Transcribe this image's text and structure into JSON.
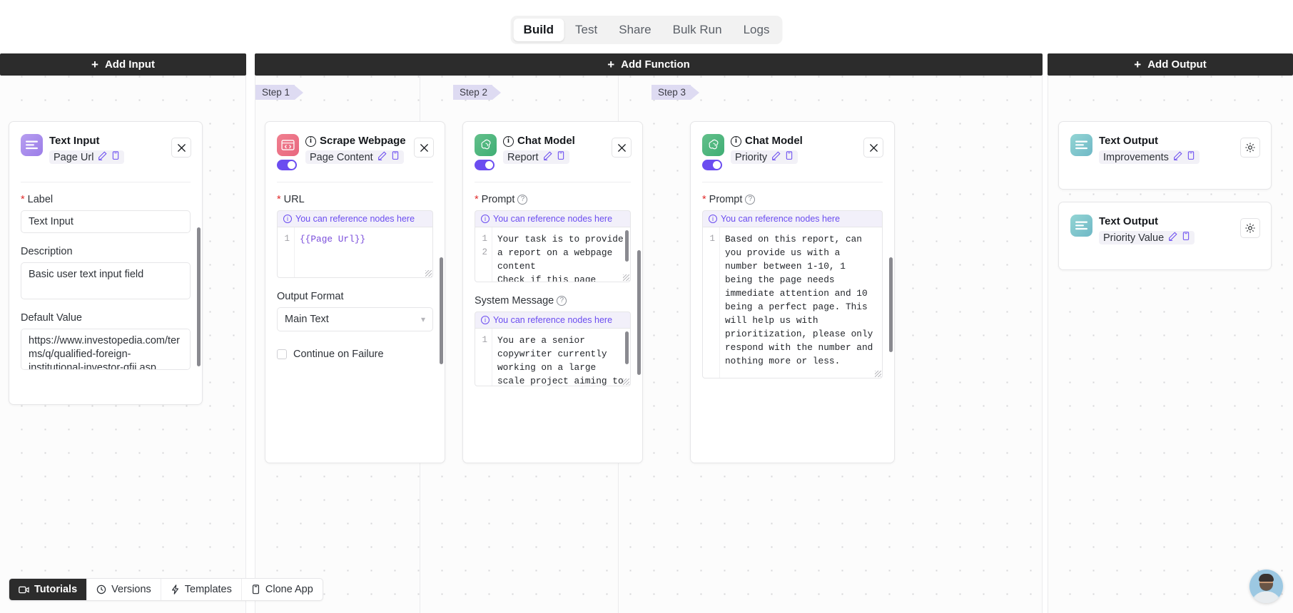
{
  "tabs": [
    {
      "label": "Build",
      "active": true
    },
    {
      "label": "Test",
      "active": false
    },
    {
      "label": "Share",
      "active": false
    },
    {
      "label": "Bulk Run",
      "active": false
    },
    {
      "label": "Logs",
      "active": false
    }
  ],
  "columns": {
    "input_add_label": "Add Input",
    "function_add_label": "Add Function",
    "output_add_label": "Add Output"
  },
  "input_node": {
    "title": "Text Input",
    "badge": "Page Url",
    "fields": {
      "label_label": "Label",
      "label_value": "Text Input",
      "description_label": "Description",
      "description_value": "Basic user text input field",
      "default_label": "Default Value",
      "default_value": "https://www.investopedia.com/terms/q/qualified-foreign-institutional-investor-qfii.asp"
    }
  },
  "steps": [
    {
      "tag": "Step 1",
      "title": "Scrape Webpage",
      "badge": "Page Content",
      "enabled": true,
      "url_label": "URL",
      "reference_hint": "You can reference nodes here",
      "url_value": "{{Page Url}}",
      "output_format_label": "Output Format",
      "output_format_value": "Main Text",
      "continue_on_failure_label": "Continue on Failure",
      "continue_on_failure_checked": false
    },
    {
      "tag": "Step 2",
      "title": "Chat Model",
      "badge": "Report",
      "enabled": true,
      "prompt_label": "Prompt",
      "reference_hint": "You can reference nodes here",
      "prompt_line1": "Your task is to provide a report on a webpage content",
      "prompt_line2": "Check if this page meets Google Helpful Content",
      "system_message_label": "System Message",
      "system_message_value": "You are a senior copywriter currently working on a large scale project aiming to improve a website's old"
    },
    {
      "tag": "Step 3",
      "title": "Chat Model",
      "badge": "Priority",
      "enabled": true,
      "prompt_label": "Prompt",
      "reference_hint": "You can reference nodes here",
      "prompt_value": "Based on this report, can you provide us with a number between 1-10, 1 being the page needs immediate attention and 10 being a perfect page. This will help us with prioritization, please only respond with the number and nothing more or less."
    }
  ],
  "output_nodes": [
    {
      "title": "Text Output",
      "badge": "Improvements"
    },
    {
      "title": "Text Output",
      "badge": "Priority Value"
    }
  ],
  "bottom_bar": [
    {
      "label": "Tutorials",
      "icon": "video-icon",
      "active": true
    },
    {
      "label": "Versions",
      "icon": "clock-icon",
      "active": false
    },
    {
      "label": "Templates",
      "icon": "lightning-icon",
      "active": false
    },
    {
      "label": "Clone App",
      "icon": "copy-icon",
      "active": false
    }
  ],
  "colors": {
    "accent_purple": "#6b4df0",
    "dark_bar": "#2c2c2c",
    "required_red": "#e02b2b",
    "step_tag": "#dedbf2"
  }
}
